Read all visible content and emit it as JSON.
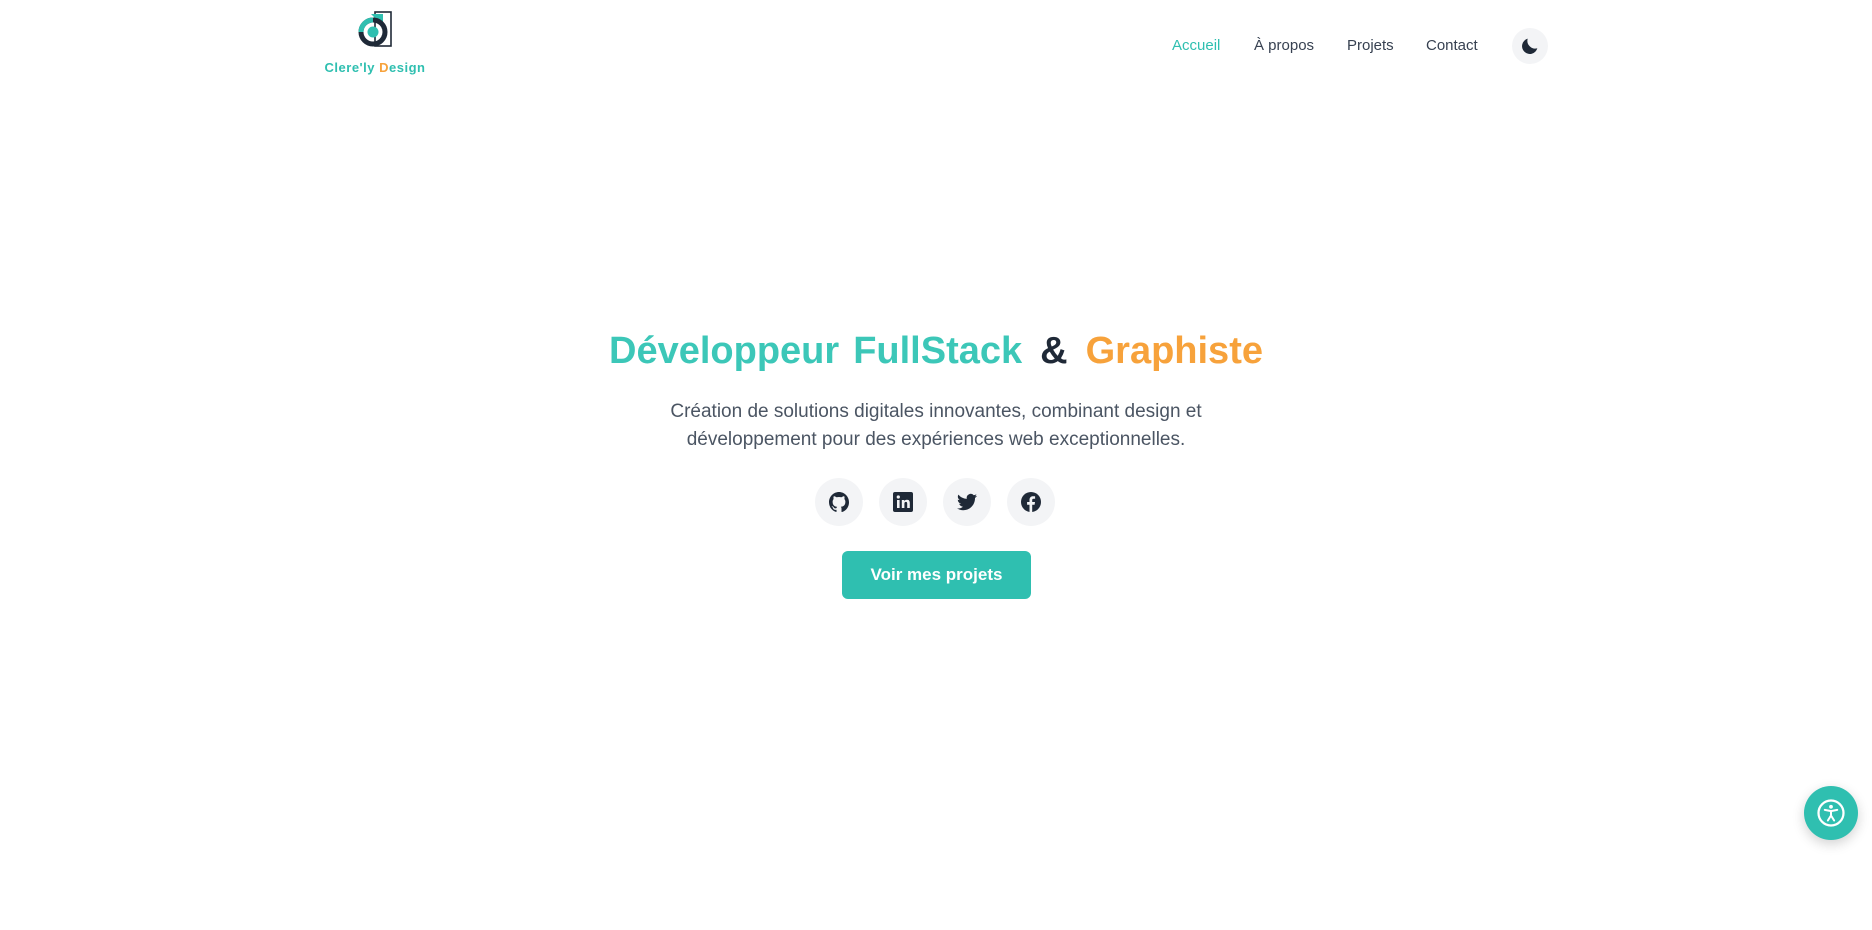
{
  "header": {
    "logo": {
      "part1": "Clere'ly ",
      "part2": "D",
      "part3": "esign",
      "mark_icon": "logo-mark-icon"
    },
    "nav": [
      {
        "label": "Accueil",
        "active": true
      },
      {
        "label": "À propos",
        "active": false
      },
      {
        "label": "Projets",
        "active": false
      },
      {
        "label": "Contact",
        "active": false
      }
    ],
    "theme_toggle_icon": "moon-icon"
  },
  "hero": {
    "title_word1": "Développeur",
    "title_word2": "FullStack",
    "title_amp": "&",
    "title_word3": "Graphiste",
    "subtitle_line1": "Création de solutions digitales innovantes, combinant design et",
    "subtitle_line2": "développement pour des expériences web exceptionnelles.",
    "socials": [
      {
        "icon": "github-icon"
      },
      {
        "icon": "linkedin-icon"
      },
      {
        "icon": "twitter-icon"
      },
      {
        "icon": "facebook-icon"
      }
    ],
    "cta_label": "Voir mes projets"
  },
  "accessibility_button_icon": "accessibility-icon",
  "colors": {
    "accent": "#2fbfb0",
    "orange": "#f7a23b",
    "text_dark": "#1f2937",
    "text_muted": "#4b5563"
  }
}
